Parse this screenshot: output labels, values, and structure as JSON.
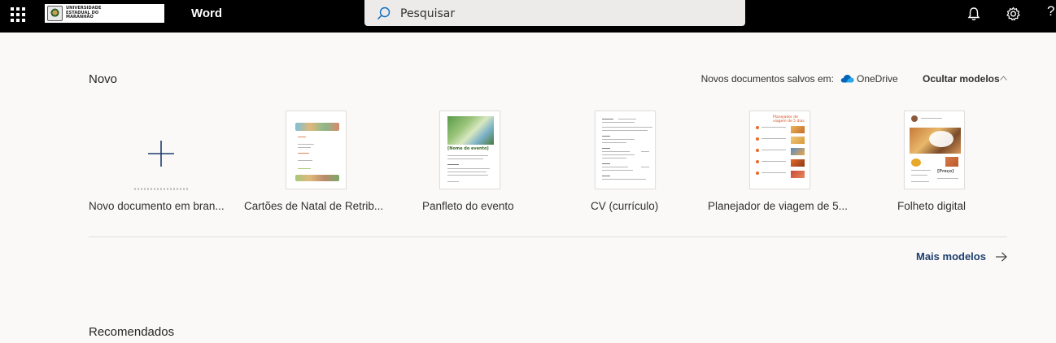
{
  "header": {
    "app_name": "Word",
    "logo_lines": [
      "UNIVERSIDADE",
      "ESTADUAL DO",
      "MARANHÃO"
    ],
    "search_placeholder": "Pesquisar",
    "help_label": "?"
  },
  "new_section": {
    "title": "Novo",
    "saved_in_label": "Novos documentos salvos em:",
    "storage_name": "OneDrive",
    "hide_templates_label": "Ocultar modelos",
    "templates": [
      {
        "label": "Novo documento em bran..."
      },
      {
        "label": "Cartões de Natal de Retrib..."
      },
      {
        "label": "Panfleto do evento"
      },
      {
        "label": "CV (currículo)"
      },
      {
        "label": "Planejador de viagem de 5..."
      },
      {
        "label": "Folheto digital"
      }
    ],
    "thumb_texts": {
      "event_name": "[Nome do evento]",
      "trip_title": "Planejador de viagem de 5 dias",
      "flyer_price": "[Preço]"
    },
    "more_templates_label": "Mais modelos"
  },
  "recommended": {
    "title": "Recomendados"
  },
  "colors": {
    "topbar": "#000000",
    "accent": "#1e3e6e",
    "onedrive": "#0364b8"
  }
}
